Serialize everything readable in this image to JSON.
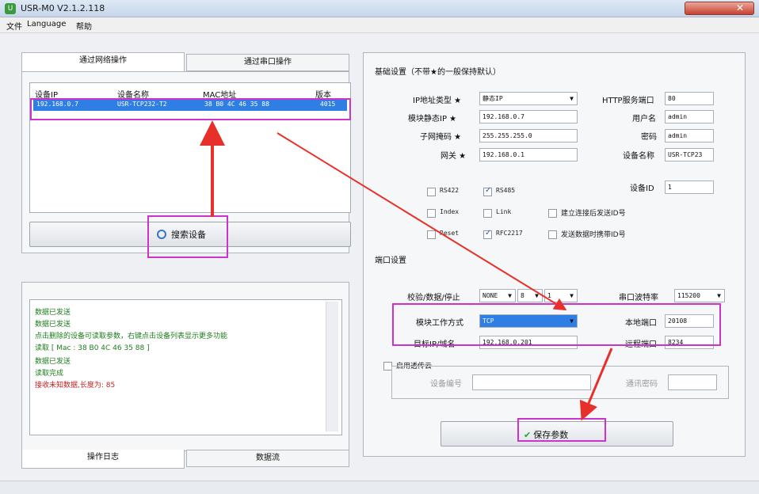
{
  "window": {
    "title": "USR-M0 V2.1.2.118"
  },
  "menu": {
    "items": [
      "文件",
      "Language",
      "帮助"
    ]
  },
  "left": {
    "tabs": [
      "通过网络操作",
      "通过串口操作"
    ],
    "columns": [
      "设备IP",
      "设备名称",
      "MAC地址",
      "版本"
    ],
    "device": {
      "ip": "192.168.0.7",
      "name": "USR-TCP232-T2",
      "mac": "38 B0 4C 46 35 88",
      "version": "4015"
    },
    "search_button": "搜索设备",
    "log_lines": [
      "数据已发送",
      "数据已发送",
      "点击删除的设备可读取参数，右键点击设备列表显示更多功能",
      "读取 [ Mac : 38 B0 4C 46 35 88 ]",
      "数据已发送",
      "读取完成",
      "接收未知数据,长度为: 85"
    ],
    "bottom_tabs": [
      "操作日志",
      "数据流"
    ]
  },
  "basic": {
    "title": "基础设置（不带★的一般保持默认）",
    "ip_type": {
      "label": "IP地址类型 ★",
      "value": "静态IP"
    },
    "module_ip": {
      "label": "模块静态IP ★",
      "value": "192.168.0.7"
    },
    "subnet": {
      "label": "子网掩码 ★",
      "value": "255.255.255.0"
    },
    "gateway": {
      "label": "网关 ★",
      "value": "192.168.0.1"
    },
    "http_port": {
      "label": "HTTP服务端口",
      "value": "80"
    },
    "username": {
      "label": "用户名",
      "value": "admin"
    },
    "password": {
      "label": "密码",
      "value": "admin"
    },
    "device_name": {
      "label": "设备名称",
      "value": "USR-TCP23"
    },
    "device_id": {
      "label": "设备ID",
      "value": "1"
    },
    "checks": {
      "rs422": {
        "label": "RS422",
        "checked": false
      },
      "rs485": {
        "label": "RS485",
        "checked": true
      },
      "index": {
        "label": "Index",
        "checked": false
      },
      "link": {
        "label": "Link",
        "checked": false
      },
      "reset": {
        "label": "Reset",
        "checked": false
      },
      "rfc2217": {
        "label": "RFC2217",
        "checked": true
      },
      "send_id_on_connect": {
        "label": "建立连接后发送ID号",
        "checked": false
      },
      "send_id_with_data": {
        "label": "发送数据时携带ID号",
        "checked": false
      }
    }
  },
  "port": {
    "title": "端口设置",
    "check_data_stop": {
      "label": "校验/数据/停止",
      "parity": "NONE",
      "bits": "8",
      "stop": "1"
    },
    "baud": {
      "label": "串口波特率",
      "value": "115200"
    },
    "work_mode": {
      "label": "模块工作方式",
      "value": "TCP"
    },
    "local_port": {
      "label": "本地端口",
      "value": "20108"
    },
    "remote_ip": {
      "label": "目标IP/域名",
      "value": "192.168.0.201"
    },
    "remote_port": {
      "label": "远程端口",
      "value": "8234"
    },
    "cloud": {
      "label": "启用透传云",
      "checked": false
    },
    "cloud_device_no": {
      "label": "设备编号",
      "value": ""
    },
    "cloud_password": {
      "label": "通讯密码",
      "value": ""
    }
  },
  "save_button": "保存参数",
  "colors": {
    "highlight": "#cc33cc",
    "arrow": "#e8302a",
    "selection": "#2f7ee3"
  }
}
